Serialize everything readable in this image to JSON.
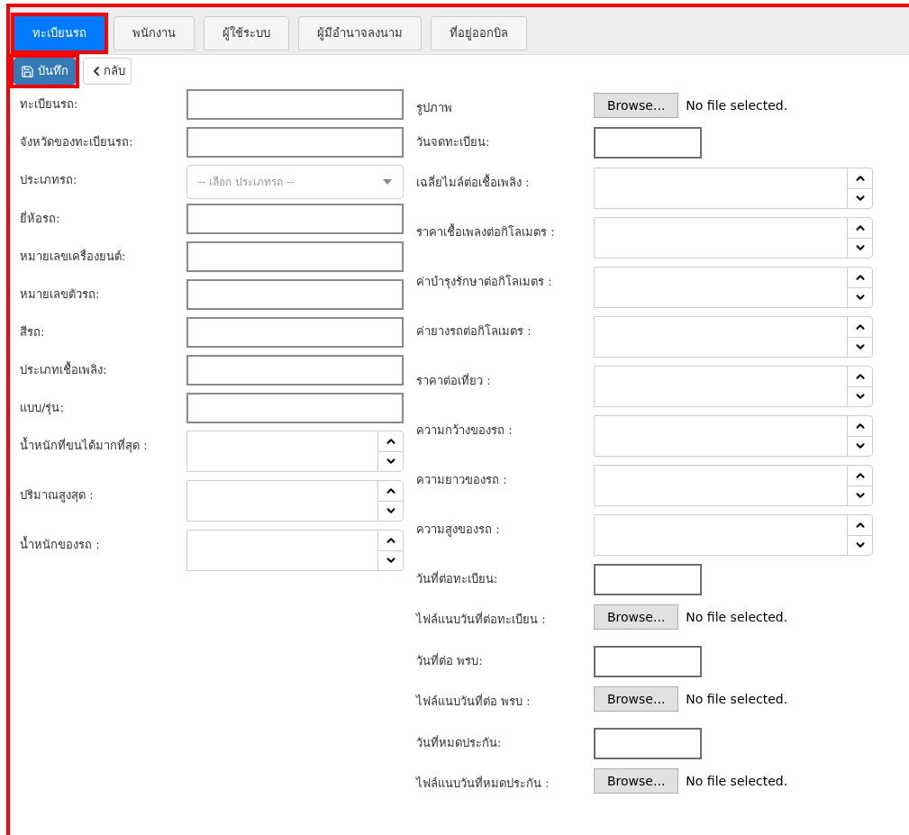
{
  "tabs": [
    {
      "label": "ทะเบียนรถ",
      "selected": true,
      "highlighted": true
    },
    {
      "label": "พนักงาน",
      "selected": false,
      "highlighted": false
    },
    {
      "label": "ผู้ใช้ระบบ",
      "selected": false,
      "highlighted": false
    },
    {
      "label": "ผู้มีอำนาจลงนาม",
      "selected": false,
      "highlighted": false
    },
    {
      "label": "ที่อยู่ออกบิล",
      "selected": false,
      "highlighted": false
    }
  ],
  "toolbar": {
    "save": {
      "label": "บันทึก",
      "highlighted": true
    },
    "back": {
      "label": "กลับ"
    }
  },
  "left_fields": [
    {
      "kind": "text",
      "label": "ทะเบียนรถ:"
    },
    {
      "kind": "text",
      "label": "จังหวัดของทะเบียนรถ:"
    },
    {
      "kind": "select",
      "label": "ประเภทรถ:",
      "placeholder": "-- เลือก ประเภทรถ --"
    },
    {
      "kind": "text",
      "label": "ยี่ห้อรถ:"
    },
    {
      "kind": "text",
      "label": "หมายเลขเครื่องยนต์:"
    },
    {
      "kind": "text",
      "label": "หมายเลขตัวรถ:"
    },
    {
      "kind": "text",
      "label": "สีรถ:"
    },
    {
      "kind": "text",
      "label": "ประเภทเชื้อเพลิง:"
    },
    {
      "kind": "text",
      "label": "แบบ/รุ่น:"
    },
    {
      "kind": "number",
      "label": "น้ำหนักที่ขนได้มากที่สุด :"
    },
    {
      "kind": "number",
      "label": "ปริมาณสูงสุด :"
    },
    {
      "kind": "number",
      "label": "น้ำหนักของรถ :"
    }
  ],
  "right_fields": [
    {
      "kind": "file",
      "label": "รูปภาพ",
      "button": "Browse...",
      "status": "No file selected."
    },
    {
      "kind": "date",
      "label": "วันจดทะเบียน:"
    },
    {
      "kind": "number",
      "label": "เฉลี่ยไมล์ต่อเชื้อเพลิง :"
    },
    {
      "kind": "number",
      "label": "ราคาเชื้อเพลงต่อกิโลเมตร :"
    },
    {
      "kind": "number",
      "label": "ค่าบำรุงรักษาต่อกิโลเมตร :"
    },
    {
      "kind": "number",
      "label": "ค่ายางรถต่อกิโลเมตร :"
    },
    {
      "kind": "number",
      "label": "ราคาต่อเที่ยว :"
    },
    {
      "kind": "number",
      "label": "ความกว้างของรถ :"
    },
    {
      "kind": "number",
      "label": "ความยาวของรถ :"
    },
    {
      "kind": "number",
      "label": "ความสูงของรถ :"
    },
    {
      "kind": "date",
      "label": "วันที่ต่อทะเบียน:"
    },
    {
      "kind": "file",
      "label": "ไฟล์แนบวันที่ต่อทะเบียน :",
      "button": "Browse...",
      "status": "No file selected."
    },
    {
      "kind": "date",
      "label": "วันที่ต่อ พรบ:"
    },
    {
      "kind": "file",
      "label": "ไฟล์แนบวันที่ต่อ พรบ :",
      "button": "Browse...",
      "status": "No file selected."
    },
    {
      "kind": "date",
      "label": "วันที่หมดประกัน:"
    },
    {
      "kind": "file",
      "label": "ไฟล์แนบวันที่หมดประกัน :",
      "button": "Browse...",
      "status": "No file selected."
    }
  ]
}
